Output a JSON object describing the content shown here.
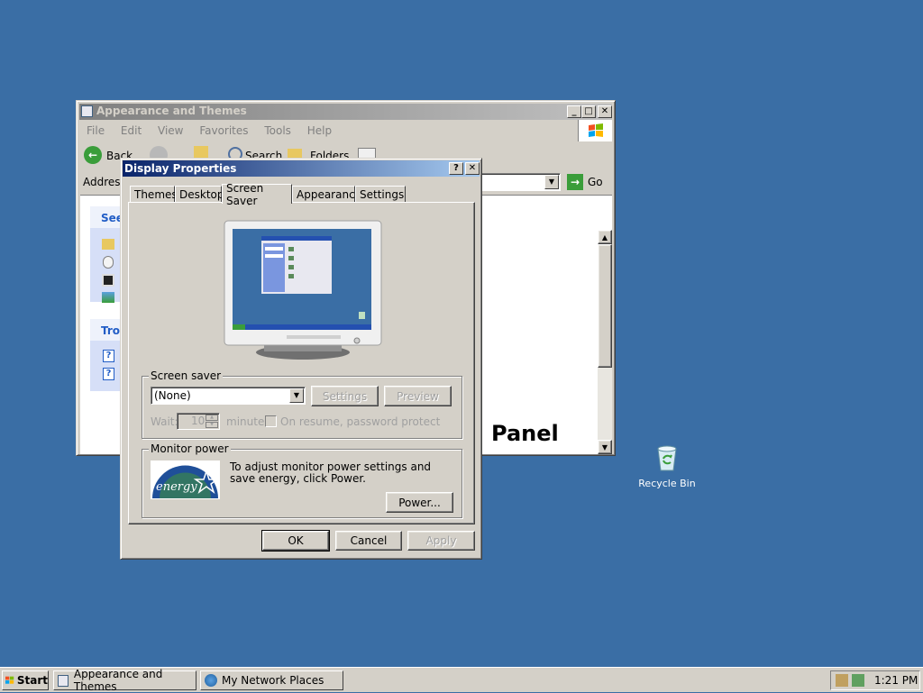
{
  "explorer": {
    "title": "Appearance and Themes",
    "menu": [
      "File",
      "Edit",
      "View",
      "Favorites",
      "Tools",
      "Help"
    ],
    "toolbar": {
      "back": "Back",
      "search": "Search",
      "folders": "Folders"
    },
    "address_label": "Address",
    "go_label": "Go",
    "see_also_header": "See",
    "troubleshoot_header": "Tro",
    "panel_text": "Panel"
  },
  "dialog": {
    "title": "Display Properties",
    "help_glyph": "?",
    "close_glyph": "✕",
    "tabs": [
      "Themes",
      "Desktop",
      "Screen Saver",
      "Appearance",
      "Settings"
    ],
    "active_tab": "Screen Saver",
    "screensaver": {
      "group_label": "Screen saver",
      "selected": "(None)",
      "settings_label": "Settings",
      "preview_label": "Preview",
      "wait_label": "Wait:",
      "wait_value": "10",
      "minutes_label": "minutes",
      "resume_label": "On resume, password protect"
    },
    "monitor_power": {
      "group_label": "Monitor power",
      "description": "To adjust monitor power settings and save energy, click Power.",
      "power_label": "Power...",
      "logo_text": "energy"
    },
    "buttons": {
      "ok": "OK",
      "cancel": "Cancel",
      "apply": "Apply"
    }
  },
  "desktop": {
    "recycle_bin_label": "Recycle Bin"
  },
  "taskbar": {
    "start_label": "Start",
    "items": [
      {
        "label": "Appearance and Themes"
      },
      {
        "label": "My Network Places"
      }
    ],
    "clock": "1:21 PM"
  },
  "colors": {
    "desktop": "#3a6ea5",
    "titlebar_start": "#0a246a",
    "titlebar_end": "#a6caf0",
    "face": "#d4d0c8"
  }
}
